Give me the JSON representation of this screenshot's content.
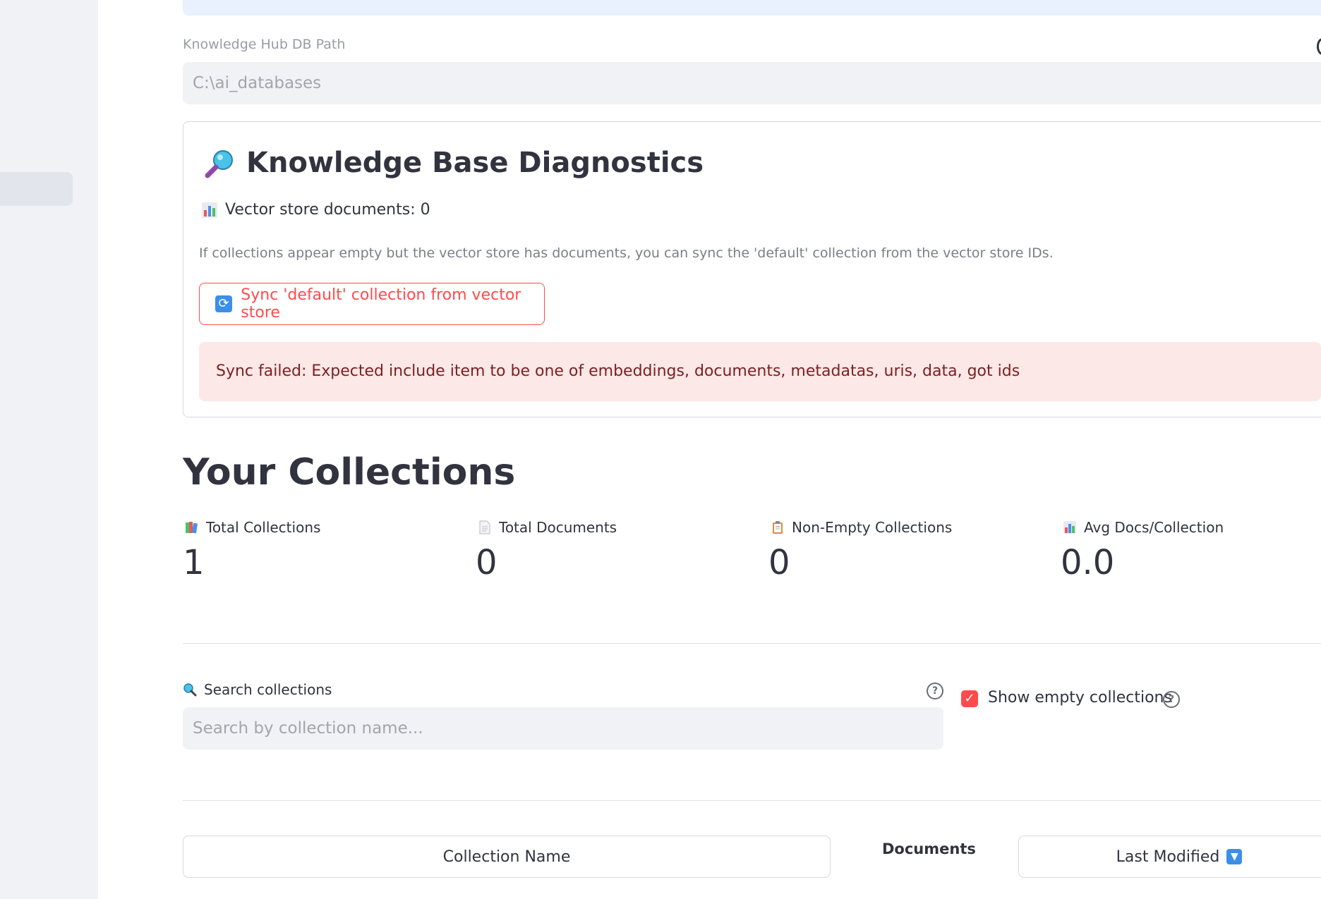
{
  "settings": {
    "db_path_label": "Knowledge Hub DB Path",
    "db_path_value": "C:\\ai_databases"
  },
  "diagnostics": {
    "title": "Knowledge Base Diagnostics",
    "title_icon": "magnifier-icon",
    "vector_store_text": "Vector store documents: 0",
    "vector_store_icon": "bar-chart-icon",
    "help_text": "If collections appear empty but the vector store has documents, you can sync the 'default' collection from the vector store IDs.",
    "sync_button_label": "Sync 'default' collection from vector store",
    "sync_button_icon": "refresh-icon",
    "error_message": "Sync failed: Expected include item to be one of embeddings, documents, metadatas, uris, data, got ids"
  },
  "collections": {
    "heading": "Your Collections",
    "metrics": [
      {
        "label": "Total Collections",
        "value": "1",
        "icon": "books-icon"
      },
      {
        "label": "Total Documents",
        "value": "0",
        "icon": "page-icon"
      },
      {
        "label": "Non-Empty Collections",
        "value": "0",
        "icon": "clipboard-icon"
      },
      {
        "label": "Avg Docs/Collection",
        "value": "0.0",
        "icon": "bar-chart-icon"
      }
    ],
    "search_label": "Search collections",
    "search_icon": "search-icon",
    "search_placeholder": "Search by collection name...",
    "show_empty_label": "Show empty collections",
    "show_empty_checked": true,
    "table_headers": {
      "name": "Collection Name",
      "documents": "Documents",
      "last_modified": "Last Modified"
    },
    "sort_icon": "sort-down-icon"
  },
  "colors": {
    "accent": "#ff4b4b",
    "error_bg": "#fde8e8",
    "error_text": "#7d2020",
    "info_bg": "#e8f1fc",
    "sidebar_bg": "#f0f2f6"
  }
}
